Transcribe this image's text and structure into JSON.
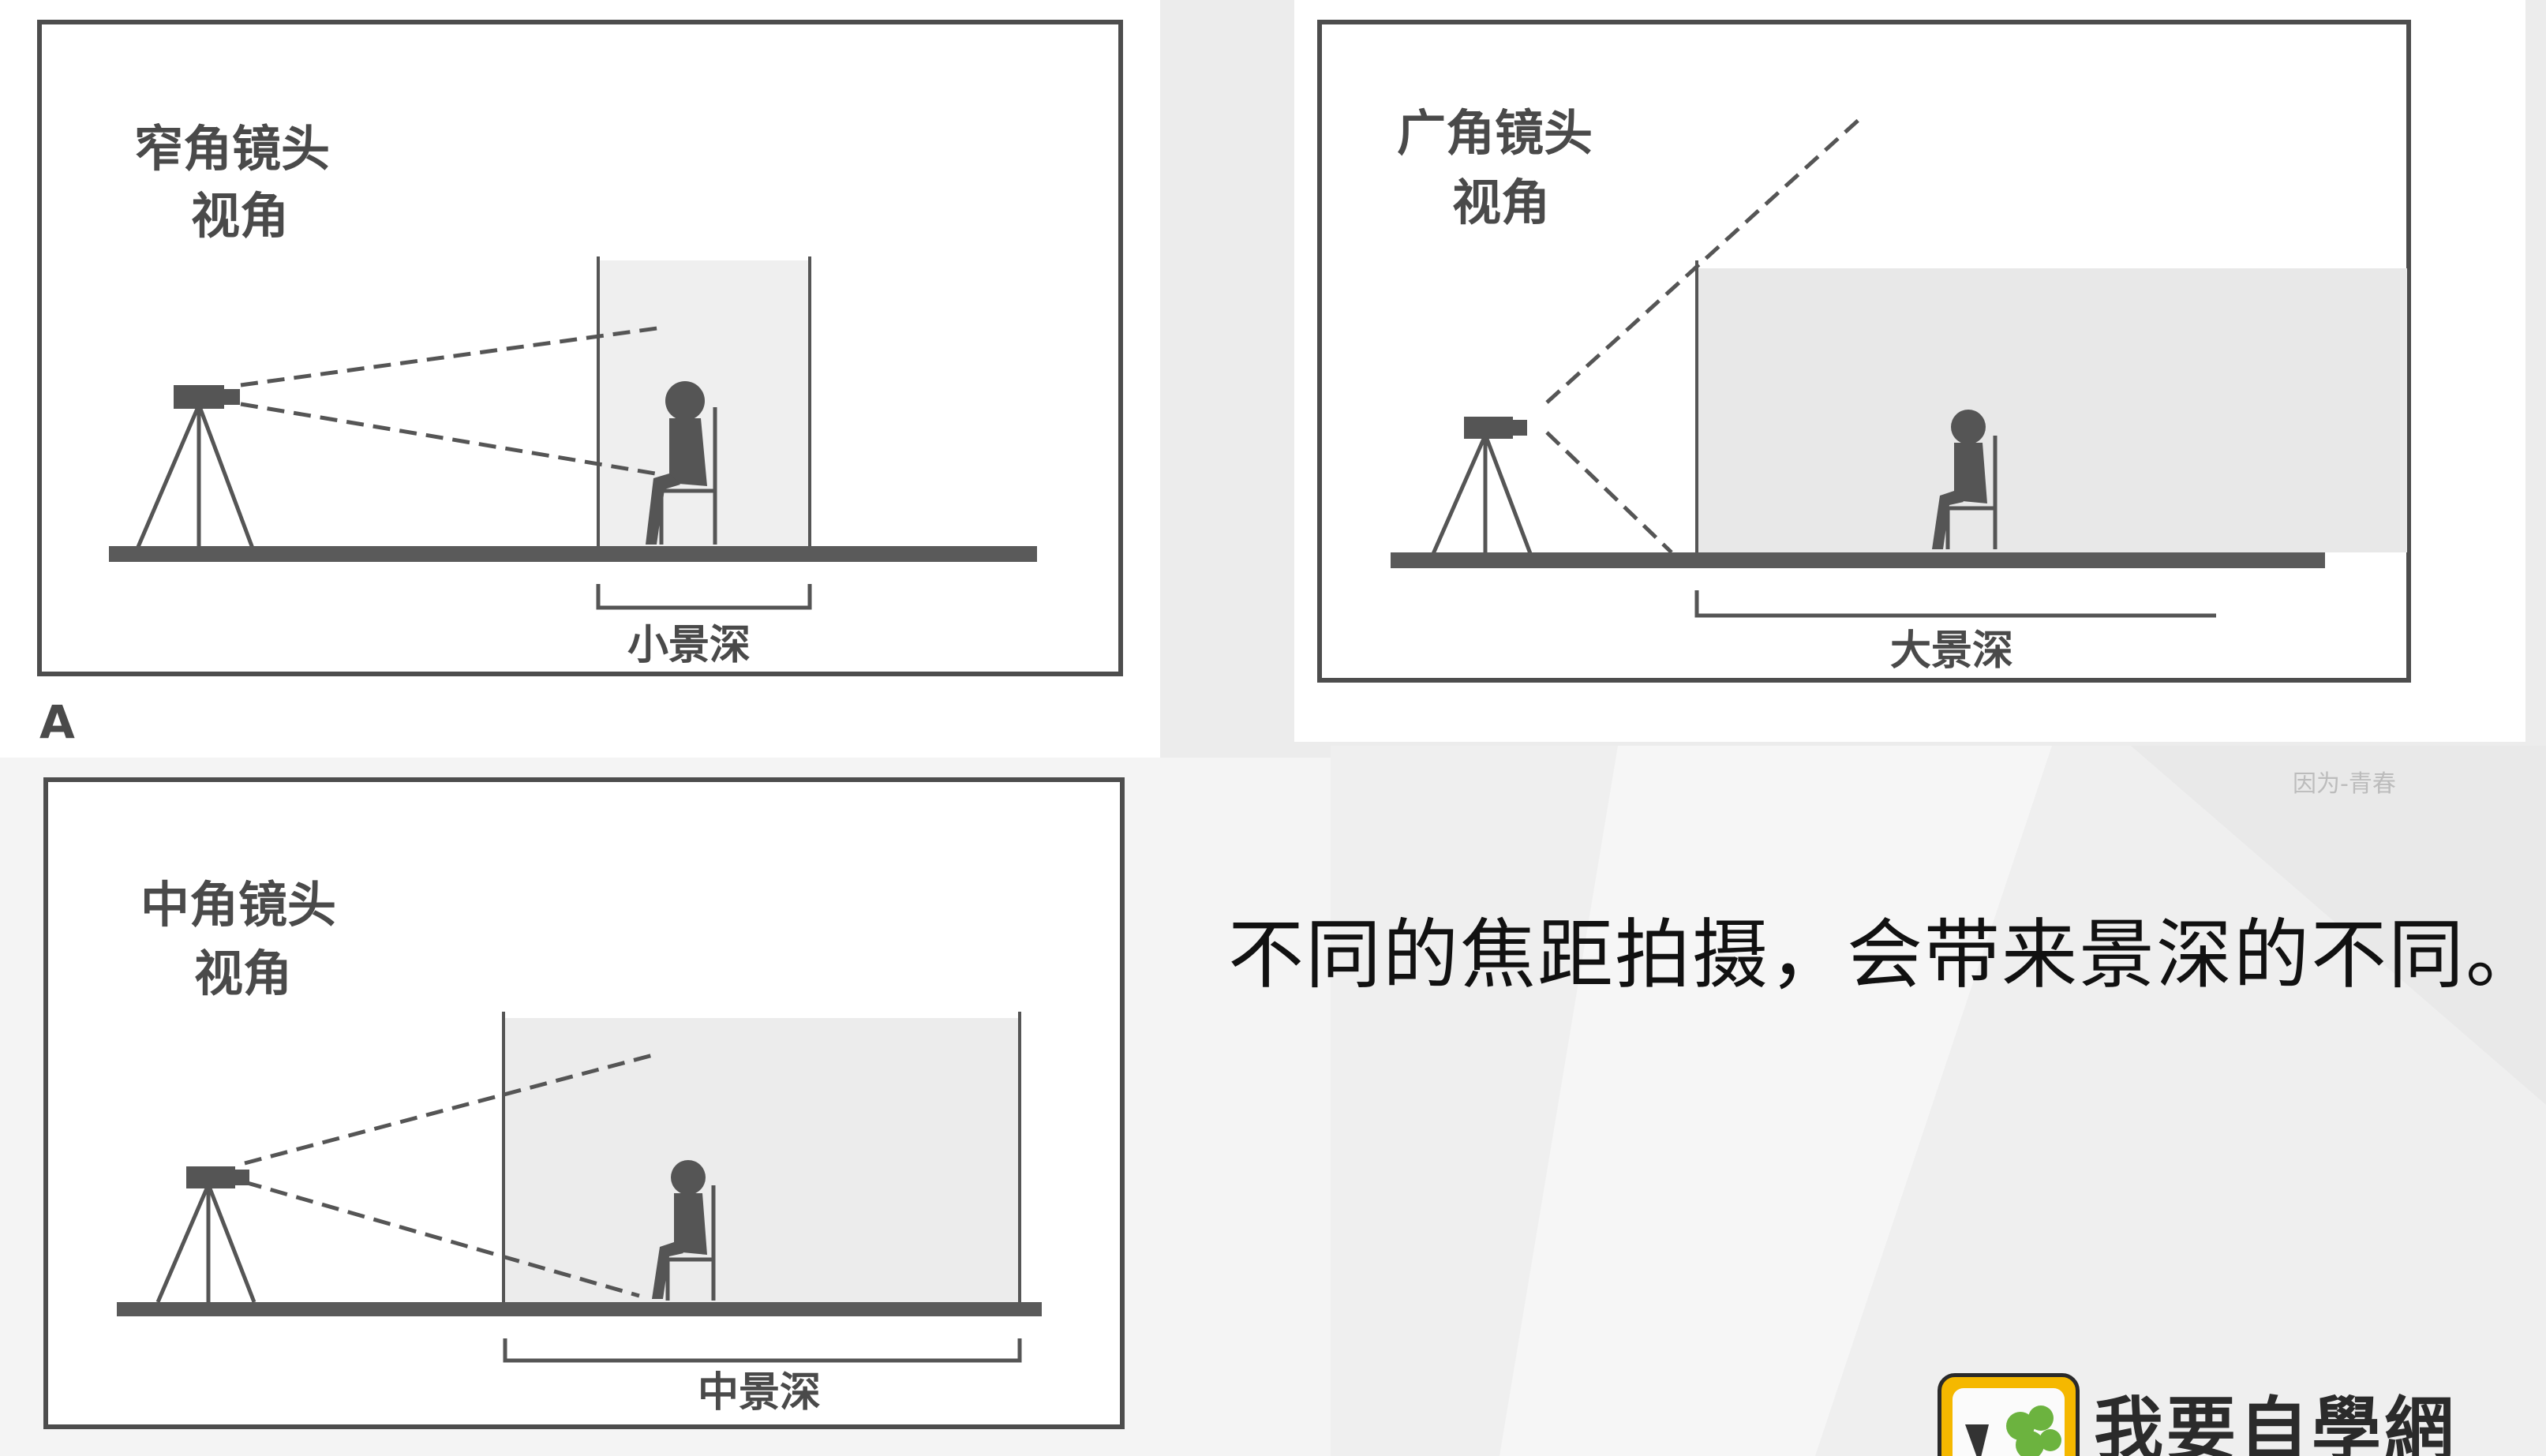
{
  "panels": {
    "narrow": {
      "title_line1": "窄角镜头",
      "title_line2": "视角",
      "depth_label": "小景深",
      "figure_letter": "A"
    },
    "wide": {
      "title_line1": "广角镜头",
      "title_line2": "视角",
      "depth_label": "大景深"
    },
    "medium": {
      "title_line1": "中角镜头",
      "title_line2": "视角",
      "depth_label": "中景深"
    }
  },
  "caption": "不同的焦距拍摄，会带来景深的不同。",
  "watermark": "因为-青春",
  "logo": {
    "text": "我要自學網"
  },
  "colors": {
    "line": "#555555",
    "ground": "#5a5a5a",
    "shade": "#e6e6e6",
    "frame": "#4d4d4d",
    "accent": "#f5b800"
  }
}
